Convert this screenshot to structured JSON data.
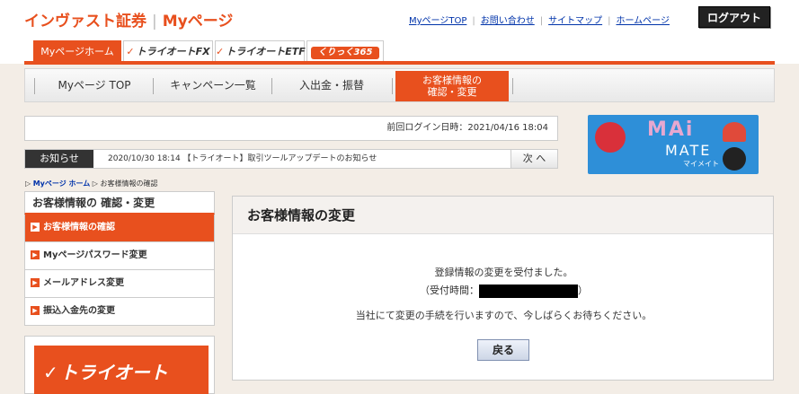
{
  "header": {
    "brand": "インヴァスト証券",
    "brand_sub": "Myページ",
    "links": [
      "MyページTOP",
      "お問い合わせ",
      "サイトマップ",
      "ホームページ"
    ],
    "logout_label": "ログアウト"
  },
  "service_tabs": [
    {
      "label": "Myページホーム"
    },
    {
      "label": "トライオートFX"
    },
    {
      "label": "トライオートETF"
    },
    {
      "label": "くりっく365"
    }
  ],
  "main_nav": {
    "items": [
      "Myページ TOP",
      "キャンペーン一覧",
      "入出金・振替"
    ],
    "active_line1": "お客様情報の",
    "active_line2": "確認・変更"
  },
  "last_login": "前回ログイン日時：2021/04/16 18:04",
  "news": {
    "label": "お知らせ",
    "text": "2020/10/30 18:14 【トライオート】取引ツールアップデートのお知らせ",
    "next": "次 へ"
  },
  "banner": {
    "title": "MAi",
    "subtitle": "MATE",
    "kana": "マイメイト"
  },
  "breadcrumb": {
    "home": "Myページ ホーム",
    "current": "お客様情報の確認"
  },
  "sidebar": {
    "title": "お客様情報の 確認・変更",
    "items": [
      {
        "label": "お客様情報の確認"
      },
      {
        "label": "Myページパスワード変更"
      },
      {
        "label": "メールアドレス変更"
      },
      {
        "label": "振込入金先の変更"
      }
    ],
    "promo_label": "トライオート"
  },
  "panel": {
    "title": "お客様情報の変更",
    "message1": "登録情報の変更を受付ました。",
    "message2_prefix": "（受付時間：",
    "message2_suffix": "）",
    "message3": "当社にて変更の手続を行いますので、今しばらくお待ちください。",
    "back_label": "戻る"
  },
  "colors": {
    "accent": "#e8501e",
    "link": "#0033aa",
    "background": "#f3ede6"
  }
}
